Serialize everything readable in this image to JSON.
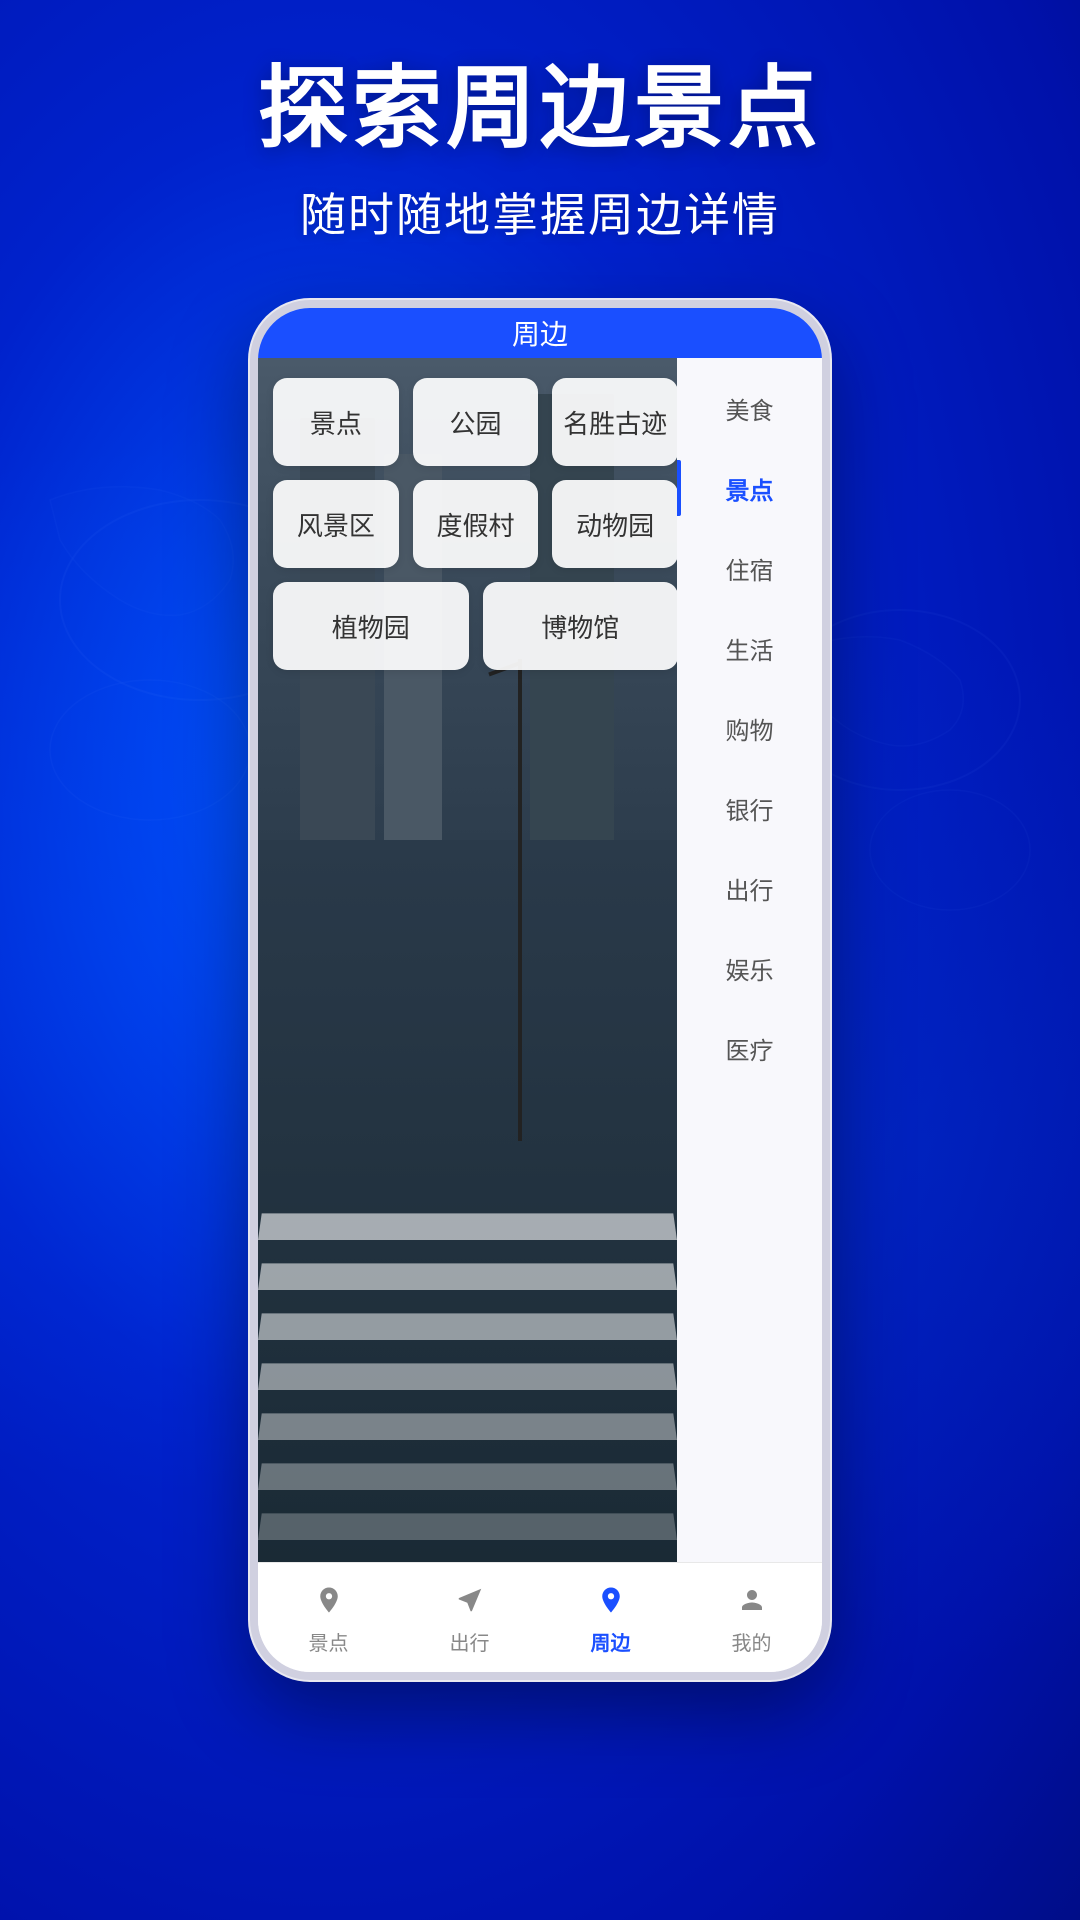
{
  "app": {
    "header_title": "探索周边景点",
    "header_subtitle": "随时随地掌握周边详情"
  },
  "phone": {
    "top_bar_title": "周边",
    "categories": [
      [
        {
          "id": "jingdian",
          "label": "景点"
        },
        {
          "id": "gongyuan",
          "label": "公园"
        },
        {
          "id": "mingsheng",
          "label": "名胜古迹"
        }
      ],
      [
        {
          "id": "fengjingqu",
          "label": "风景区"
        },
        {
          "id": "dujiacun",
          "label": "度假村"
        },
        {
          "id": "dongwuyuan",
          "label": "动物园"
        }
      ],
      [
        {
          "id": "zhiwuyuan",
          "label": "植物园"
        },
        {
          "id": "bowuguan",
          "label": "博物馆"
        }
      ]
    ],
    "side_menu": [
      {
        "id": "meishi",
        "label": "美食",
        "active": false
      },
      {
        "id": "jingdian_side",
        "label": "景点",
        "active": true
      },
      {
        "id": "zhushu",
        "label": "住宿",
        "active": false
      },
      {
        "id": "shenghuo",
        "label": "生活",
        "active": false
      },
      {
        "id": "gouwu",
        "label": "购物",
        "active": false
      },
      {
        "id": "yinhang",
        "label": "银行",
        "active": false
      },
      {
        "id": "chuxing",
        "label": "出行",
        "active": false
      },
      {
        "id": "yule",
        "label": "娱乐",
        "active": false
      },
      {
        "id": "yiliao",
        "label": "医疗",
        "active": false
      }
    ],
    "bottom_nav": [
      {
        "id": "jingdian_nav",
        "label": "景点",
        "icon": "person-pin",
        "active": false
      },
      {
        "id": "chuxing_nav",
        "label": "出行",
        "icon": "navigation",
        "active": false
      },
      {
        "id": "zhoubian_nav",
        "label": "周边",
        "icon": "location",
        "active": true
      },
      {
        "id": "wode_nav",
        "label": "我的",
        "icon": "person",
        "active": false
      }
    ]
  },
  "colors": {
    "primary": "#1a4fff",
    "background": "#0033ff",
    "active_text": "#1a4fff",
    "inactive_text": "#888888"
  }
}
